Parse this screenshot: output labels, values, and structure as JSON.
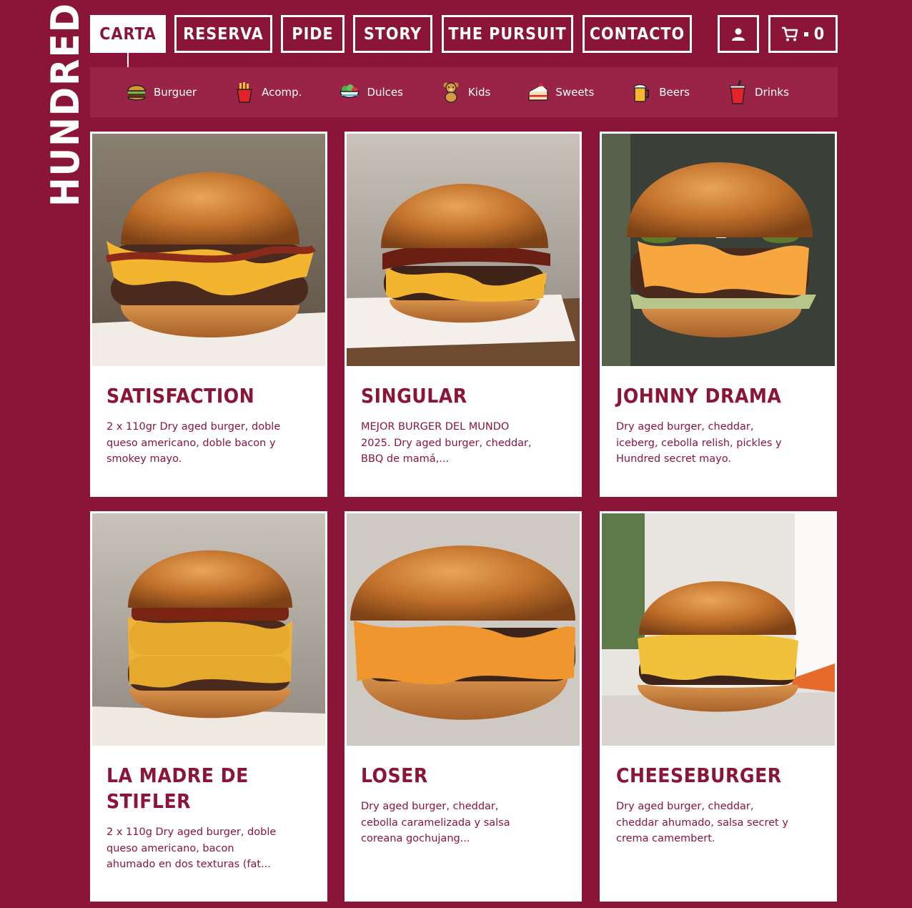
{
  "brand": {
    "logo_text": "HUNDRED"
  },
  "nav": {
    "items": [
      "CARTA",
      "RESERVA",
      "PIDE",
      "STORY",
      "THE PURSUIT",
      "CONTACTO"
    ],
    "active": "CARTA",
    "account_icon": "user-icon",
    "cart_icon": "cart-icon",
    "cart_count": "0"
  },
  "categories": [
    {
      "label": "Burguer",
      "icon": "burger-icon"
    },
    {
      "label": "Acomp.",
      "icon": "fries-icon"
    },
    {
      "label": "Dulces",
      "icon": "salad-bowl-icon"
    },
    {
      "label": "Kids",
      "icon": "teddy-bear-icon"
    },
    {
      "label": "Sweets",
      "icon": "cake-icon"
    },
    {
      "label": "Beers",
      "icon": "beer-mug-icon"
    },
    {
      "label": "Drinks",
      "icon": "soda-cup-icon"
    }
  ],
  "products": [
    {
      "name": "SATISFACTION",
      "desc": "2 x 110gr Dry aged burger, doble queso americano, doble bacon y smokey mayo."
    },
    {
      "name": "SINGULAR",
      "desc": "MEJOR BURGER DEL MUNDO 2025. Dry aged burger, cheddar, BBQ de mamá,..."
    },
    {
      "name": "JOHNNY DRAMA",
      "desc": "Dry aged burger, cheddar, iceberg, cebolla relish, pickles y Hundred secret mayo."
    },
    {
      "name": "LA MADRE DE STIFLER",
      "desc": "2 x 110g Dry aged burger, doble queso americano, bacon ahumado en dos texturas (fat..."
    },
    {
      "name": "LOSER",
      "desc": "Dry aged burger, cheddar, cebolla caramelizada y salsa coreana gochujang..."
    },
    {
      "name": "CHEESEBURGER",
      "desc": "Dry aged burger, cheddar, cheddar ahumado, salsa secret y crema camembert."
    }
  ],
  "colors": {
    "brand": "#8b1538",
    "band": "#9a2447",
    "bun": "#c8782f",
    "cheese": "#f3b430",
    "patty": "#4a2a1c"
  }
}
